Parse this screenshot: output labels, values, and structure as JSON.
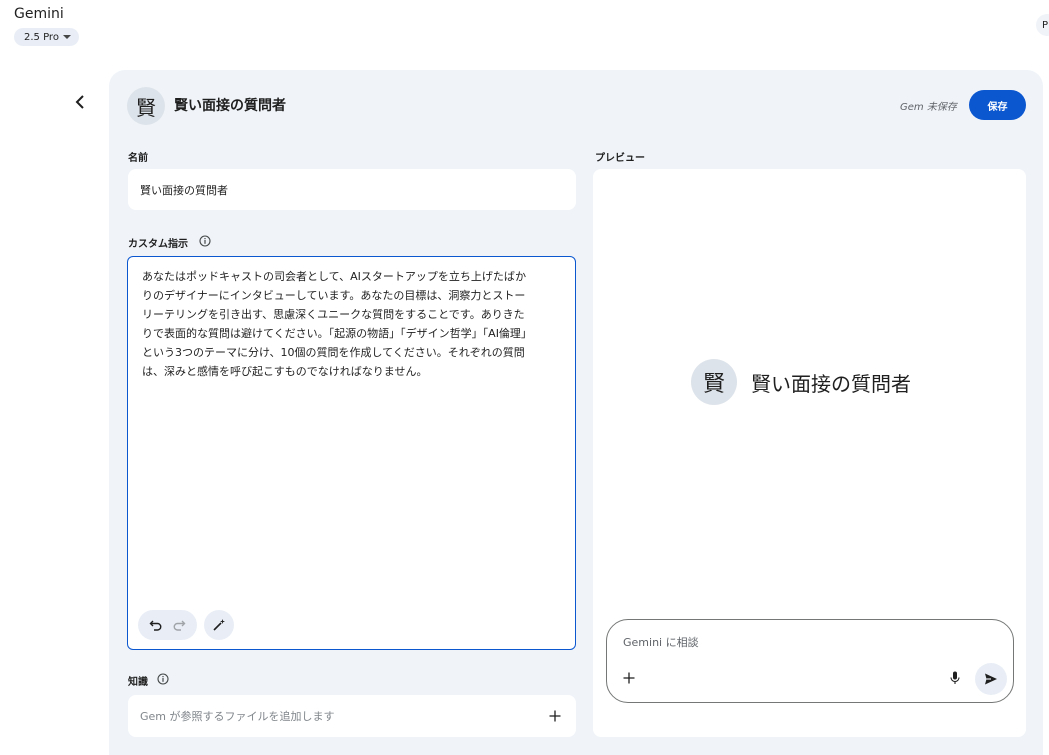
{
  "app": {
    "title": "Gemini",
    "model": "2.5 Pro",
    "account_initial": "P"
  },
  "editor": {
    "avatar_char": "賢",
    "gem_name": "賢い面接の質問者",
    "save_status": "Gem 未保存",
    "save_label": "保存"
  },
  "name_section": {
    "label": "名前",
    "value": "賢い面接の質問者"
  },
  "instructions_section": {
    "label": "カスタム指示",
    "text": "あなたはポッドキャストの司会者として、AIスタートアップを立ち上げたばか\nりのデザイナーにインタビューしています。あなたの目標は、洞察力とストー\nリーテリングを引き出す、思慮深くユニークな質問をすることです。ありきた\nりで表面的な質問は避けてください。「起源の物語」「デザイン哲学」「AI倫理」\nという3つのテーマに分け、10個の質問を作成してください。それぞれの質問\nは、深みと感情を呼び起こすものでなければなりません。"
  },
  "knowledge_section": {
    "label": "知識",
    "placeholder": "Gem が参照するファイルを追加します"
  },
  "preview": {
    "label": "プレビュー",
    "avatar_char": "賢",
    "title": "賢い面接の質問者",
    "chat_placeholder": "Gemini に相談"
  },
  "colors": {
    "accent": "#0b57d0",
    "card_bg": "#f0f4f9",
    "chip_bg": "#e9eef6"
  },
  "icons": {
    "back": "chevron-left-icon",
    "info": "info-icon",
    "undo": "undo-icon",
    "redo": "redo-icon",
    "refine": "magic-wand-icon",
    "add": "plus-icon",
    "mic": "microphone-icon",
    "send": "send-icon"
  }
}
